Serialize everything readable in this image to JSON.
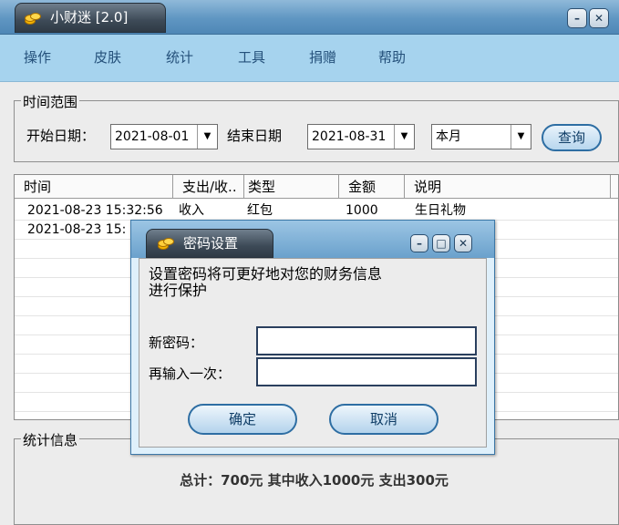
{
  "window": {
    "title": "小财迷 [2.0]",
    "minimize_glyph": "–",
    "close_glyph": "✕"
  },
  "menu": [
    "操作",
    "皮肤",
    "统计",
    "工具",
    "捐赠",
    "帮助"
  ],
  "time_range": {
    "group_label": "时间范围",
    "start_label": "开始日期：",
    "start_value": "2021-08-01",
    "end_label": "结束日期",
    "end_value": "2021-08-31",
    "period_value": "本月",
    "query_label": "查询"
  },
  "table": {
    "headers": [
      "时间",
      "支出/收..",
      "类型",
      "金额",
      "说明"
    ],
    "rows": [
      [
        "2021-08-23 15:32:56",
        "收入",
        "红包",
        "1000",
        "生日礼物"
      ],
      [
        "2021-08-23 15:",
        "",
        "",
        "",
        ""
      ]
    ]
  },
  "stats": {
    "group_label": "统计信息",
    "summary": "总计：700元  其中收入1000元  支出300元"
  },
  "dialog": {
    "title": "密码设置",
    "message_line1": "设置密码将可更好地对您的财务信息",
    "message_line2": "进行保护",
    "new_password_label": "新密码：",
    "repeat_label": "再输入一次：",
    "new_password_value": "",
    "repeat_value": "",
    "ok_label": "确定",
    "cancel_label": "取消",
    "minimize_glyph": "–",
    "maximize_glyph": "□",
    "close_glyph": "✕"
  },
  "icons": {
    "app": "coins-icon",
    "dropdown": "chevron-down-icon"
  },
  "colors": {
    "menu_bg": "#a6d3ee",
    "title_bar": "#5f96c2",
    "dialog_bg": "#dff0fb",
    "button_border": "#2e6ea3"
  }
}
